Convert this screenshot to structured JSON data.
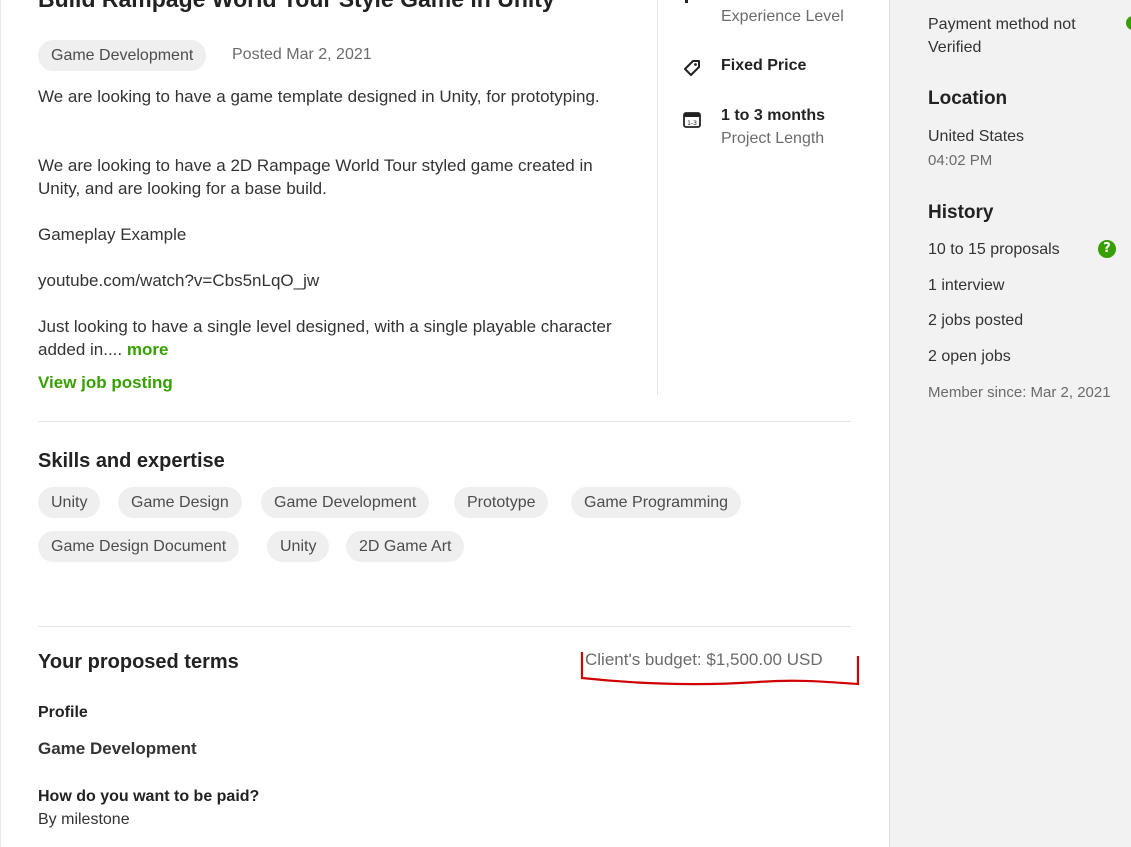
{
  "job": {
    "title": "Build Rampage World Tour Style Game in Unity",
    "category": "Game Development",
    "posted": "Posted Mar 2, 2021",
    "description": [
      "We are looking to have a game template designed in Unity, for prototyping.",
      "We are looking to have a 2D Rampage World Tour styled game created in Unity, and are looking for a base build.",
      "Gameplay Example",
      "youtube.com/watch?v=Cbs5nLqO_jw",
      "Just looking to have a single level designed, with a single playable character added in...."
    ],
    "more_link": "more",
    "view_posting_link": "View job posting"
  },
  "meta": {
    "experience_label": "Experience Level",
    "price_type": "Fixed Price",
    "project_length_value": "1 to 3 months",
    "project_length_label": "Project Length",
    "icons": [
      "tag-icon",
      "calendar-icon"
    ]
  },
  "skills": {
    "title": "Skills and expertise",
    "items": [
      "Unity",
      "Game Design",
      "Game Development",
      "Prototype",
      "Game Programming",
      "Game Design Document",
      "Unity",
      "2D Game Art"
    ]
  },
  "terms": {
    "title": "Your proposed terms",
    "budget": "Client's budget: $1,500.00 USD",
    "profile_label": "Profile",
    "profile_value": "Game Development",
    "paid_label": "How do you want to be paid?",
    "paid_value": "By milestone"
  },
  "client": {
    "payment_line1": "Payment method not",
    "payment_line2": "Verified",
    "location_title": "Location",
    "country": "United States",
    "local_time": "04:02 PM",
    "history_title": "History",
    "proposals": "10 to 15 proposals",
    "interviews": "1 interview",
    "jobs_posted": "2 jobs posted",
    "open_jobs": "2 open jobs",
    "member_since": "Member since: Mar 2, 2021"
  },
  "colors": {
    "accent_green": "#37a000",
    "annotation_red": "#d00000"
  }
}
